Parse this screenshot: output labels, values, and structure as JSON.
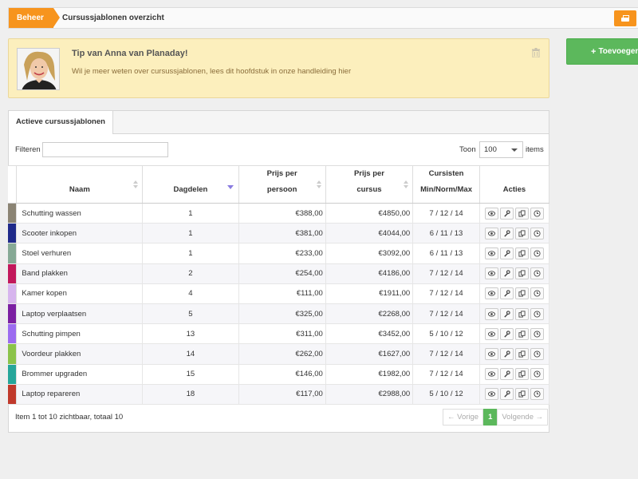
{
  "breadcrumb": {
    "home": "Beheer",
    "current": "Cursussjablonen overzicht"
  },
  "tip": {
    "title": "Tip van Anna van Planaday!",
    "text": "Wil je meer weten over cursussjablonen, lees dit hoofdstuk in onze handleiding ",
    "link": "hier"
  },
  "add_button": "Toevoegen",
  "tab": "Actieve cursussjablonen",
  "filter": {
    "label": "Filteren",
    "value": "",
    "placeholder": ""
  },
  "toon": {
    "label": "Toon",
    "value": "100",
    "suffix": "items"
  },
  "columns": {
    "naam": "Naam",
    "dagdelen": "Dagdelen",
    "prijs_persoon_1": "Prijs per",
    "prijs_persoon_2": "persoon",
    "prijs_cursus_1": "Prijs per",
    "prijs_cursus_2": "cursus",
    "cursisten_1": "Cursisten",
    "cursisten_2": "Min/Norm/Max",
    "acties": "Acties"
  },
  "rows": [
    {
      "color": "#8b8474",
      "name": "Schutting wassen",
      "dagdelen": "1",
      "prijs_persoon": "€388,00",
      "prijs_cursus": "€4850,00",
      "cursisten": "7 / 12 / 14"
    },
    {
      "color": "#1f2a8a",
      "name": "Scooter inkopen",
      "dagdelen": "1",
      "prijs_persoon": "€381,00",
      "prijs_cursus": "€4044,00",
      "cursisten": "6 / 11 / 13"
    },
    {
      "color": "#86a995",
      "name": "Stoel verhuren",
      "dagdelen": "1",
      "prijs_persoon": "€233,00",
      "prijs_cursus": "€3092,00",
      "cursisten": "6 / 11 / 13"
    },
    {
      "color": "#c2185b",
      "name": "Band plakken",
      "dagdelen": "2",
      "prijs_persoon": "€254,00",
      "prijs_cursus": "€4186,00",
      "cursisten": "7 / 12 / 14"
    },
    {
      "color": "#d7b5ee",
      "name": "Kamer kopen",
      "dagdelen": "4",
      "prijs_persoon": "€111,00",
      "prijs_cursus": "€1911,00",
      "cursisten": "7 / 12 / 14"
    },
    {
      "color": "#7b1fa2",
      "name": "Laptop verplaatsen",
      "dagdelen": "5",
      "prijs_persoon": "€325,00",
      "prijs_cursus": "€2268,00",
      "cursisten": "7 / 12 / 14"
    },
    {
      "color": "#9c6cf0",
      "name": "Schutting pimpen",
      "dagdelen": "13",
      "prijs_persoon": "€311,00",
      "prijs_cursus": "€3452,00",
      "cursisten": "5 / 10 / 12"
    },
    {
      "color": "#8bc34a",
      "name": "Voordeur plakken",
      "dagdelen": "14",
      "prijs_persoon": "€262,00",
      "prijs_cursus": "€1627,00",
      "cursisten": "7 / 12 / 14"
    },
    {
      "color": "#26a69a",
      "name": "Brommer upgraden",
      "dagdelen": "15",
      "prijs_persoon": "€146,00",
      "prijs_cursus": "€1982,00",
      "cursisten": "7 / 12 / 14"
    },
    {
      "color": "#c0392b",
      "name": "Laptop repareren",
      "dagdelen": "18",
      "prijs_persoon": "€117,00",
      "prijs_cursus": "€2988,00",
      "cursisten": "5 / 10 / 12"
    }
  ],
  "action_icons": [
    "eye-icon",
    "wrench-icon",
    "copy-icon",
    "clock-icon"
  ],
  "footer": {
    "summary": "Item 1 tot 10 zichtbaar, totaal 10",
    "prev": "← Vorige",
    "page": "1",
    "next": "Volgende →"
  },
  "colors": {
    "accent_orange": "#f7941d",
    "accent_green": "#5cb85c",
    "tip_bg": "#fcefbd"
  }
}
